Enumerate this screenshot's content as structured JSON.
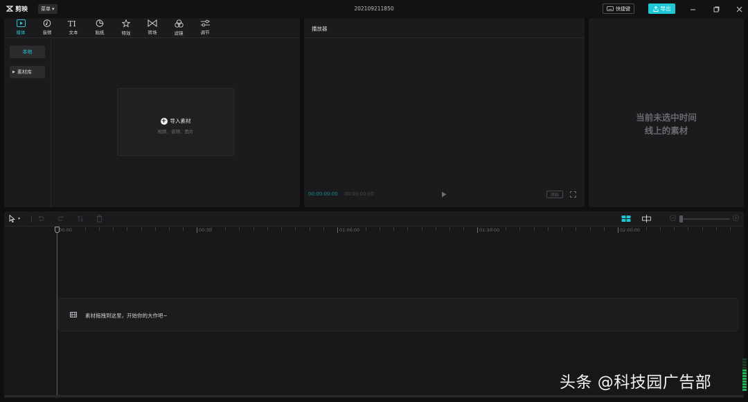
{
  "titlebar": {
    "app_name": "剪映",
    "menu_label": "菜单",
    "project_title": "202109211850",
    "shortcut_label": "快捷键",
    "export_label": "导出"
  },
  "media_panel": {
    "tabs": [
      {
        "label": "媒体",
        "icon": "media-icon",
        "active": true
      },
      {
        "label": "音频",
        "icon": "audio-icon",
        "active": false
      },
      {
        "label": "文本",
        "icon": "text-icon",
        "active": false
      },
      {
        "label": "贴纸",
        "icon": "sticker-icon",
        "active": false
      },
      {
        "label": "特效",
        "icon": "effects-icon",
        "active": false
      },
      {
        "label": "转场",
        "icon": "transition-icon",
        "active": false
      },
      {
        "label": "滤镜",
        "icon": "filter-icon",
        "active": false
      },
      {
        "label": "调节",
        "icon": "adjust-icon",
        "active": false
      }
    ],
    "side_local": "本地",
    "side_library": "素材库",
    "import_title": "导入素材",
    "import_sub": "视频、音频、图片"
  },
  "player": {
    "title": "播放器",
    "current_time": "00:00:00:00",
    "total_time": "00:00:00:00",
    "ratio_label": "原始"
  },
  "properties": {
    "empty_line1": "当前未选中时间",
    "empty_line2": "线上的素材"
  },
  "timeline": {
    "ruler_labels": [
      "00:00",
      "00:30",
      "01:00:00",
      "01:30:00",
      "02:00:00"
    ],
    "drop_hint": "素材拖拽到这里，开始你的大作吧~"
  },
  "watermark": "头条 @科技园广告部",
  "colors": {
    "accent": "#1fc7d4",
    "panel": "#1b1b1d",
    "background": "#0f0f10"
  }
}
